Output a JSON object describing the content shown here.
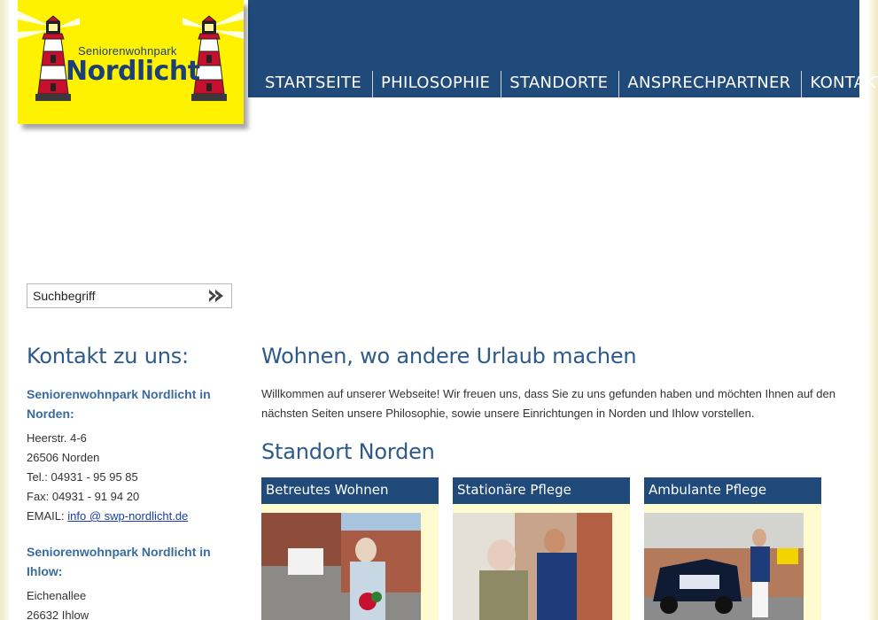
{
  "logo": {
    "small_text": "Seniorenwohnpark",
    "big_text": "Nordlicht"
  },
  "nav": {
    "items": [
      {
        "label": "STARTSEITE"
      },
      {
        "label": "PHILOSOPHIE"
      },
      {
        "label": "STANDORTE"
      },
      {
        "label": "ANSPRECHPARTNER"
      },
      {
        "label": "KONTAKT"
      }
    ]
  },
  "search": {
    "placeholder": "Suchbegriff",
    "icon": "double-chevron-right-icon"
  },
  "sidebar": {
    "title": "Kontakt zu uns:",
    "locations": [
      {
        "name": "Seniorenwohnpark Nordlicht in Norden:",
        "street": "Heerstr. 4-6",
        "city": "26506 Norden",
        "phone": "Tel.: 04931 - 95 95 85",
        "fax": "Fax: 04931 - 91 94 20",
        "email_label": "EMAIL:",
        "email": "info @ swp-nordlicht.de"
      },
      {
        "name": "Seniorenwohnpark Nordlicht in Ihlow:",
        "street": "Eichenallee",
        "city": "26632 Ihlow"
      }
    ]
  },
  "main": {
    "title": "Wohnen, wo andere Urlaub machen",
    "intro": "Willkommen auf unserer Webseite! Wir freuen uns, dass Sie zu uns gefunden haben und möchten Ihnen auf den nächsten Seiten unsere Philosophie, sowie unsere Einrichtungen in Norden und Ihlow vorstellen.",
    "section_title": "Standort Norden",
    "cards": [
      {
        "title": "Betreutes Wohnen"
      },
      {
        "title": "Stationäre Pflege"
      },
      {
        "title": "Ambulante Pflege"
      }
    ]
  },
  "colors": {
    "header_blue": "#1f4a7a",
    "logo_yellow": "#fff200",
    "heading_blue": "#2d5a8a",
    "card_bg": "#fffbd0"
  }
}
